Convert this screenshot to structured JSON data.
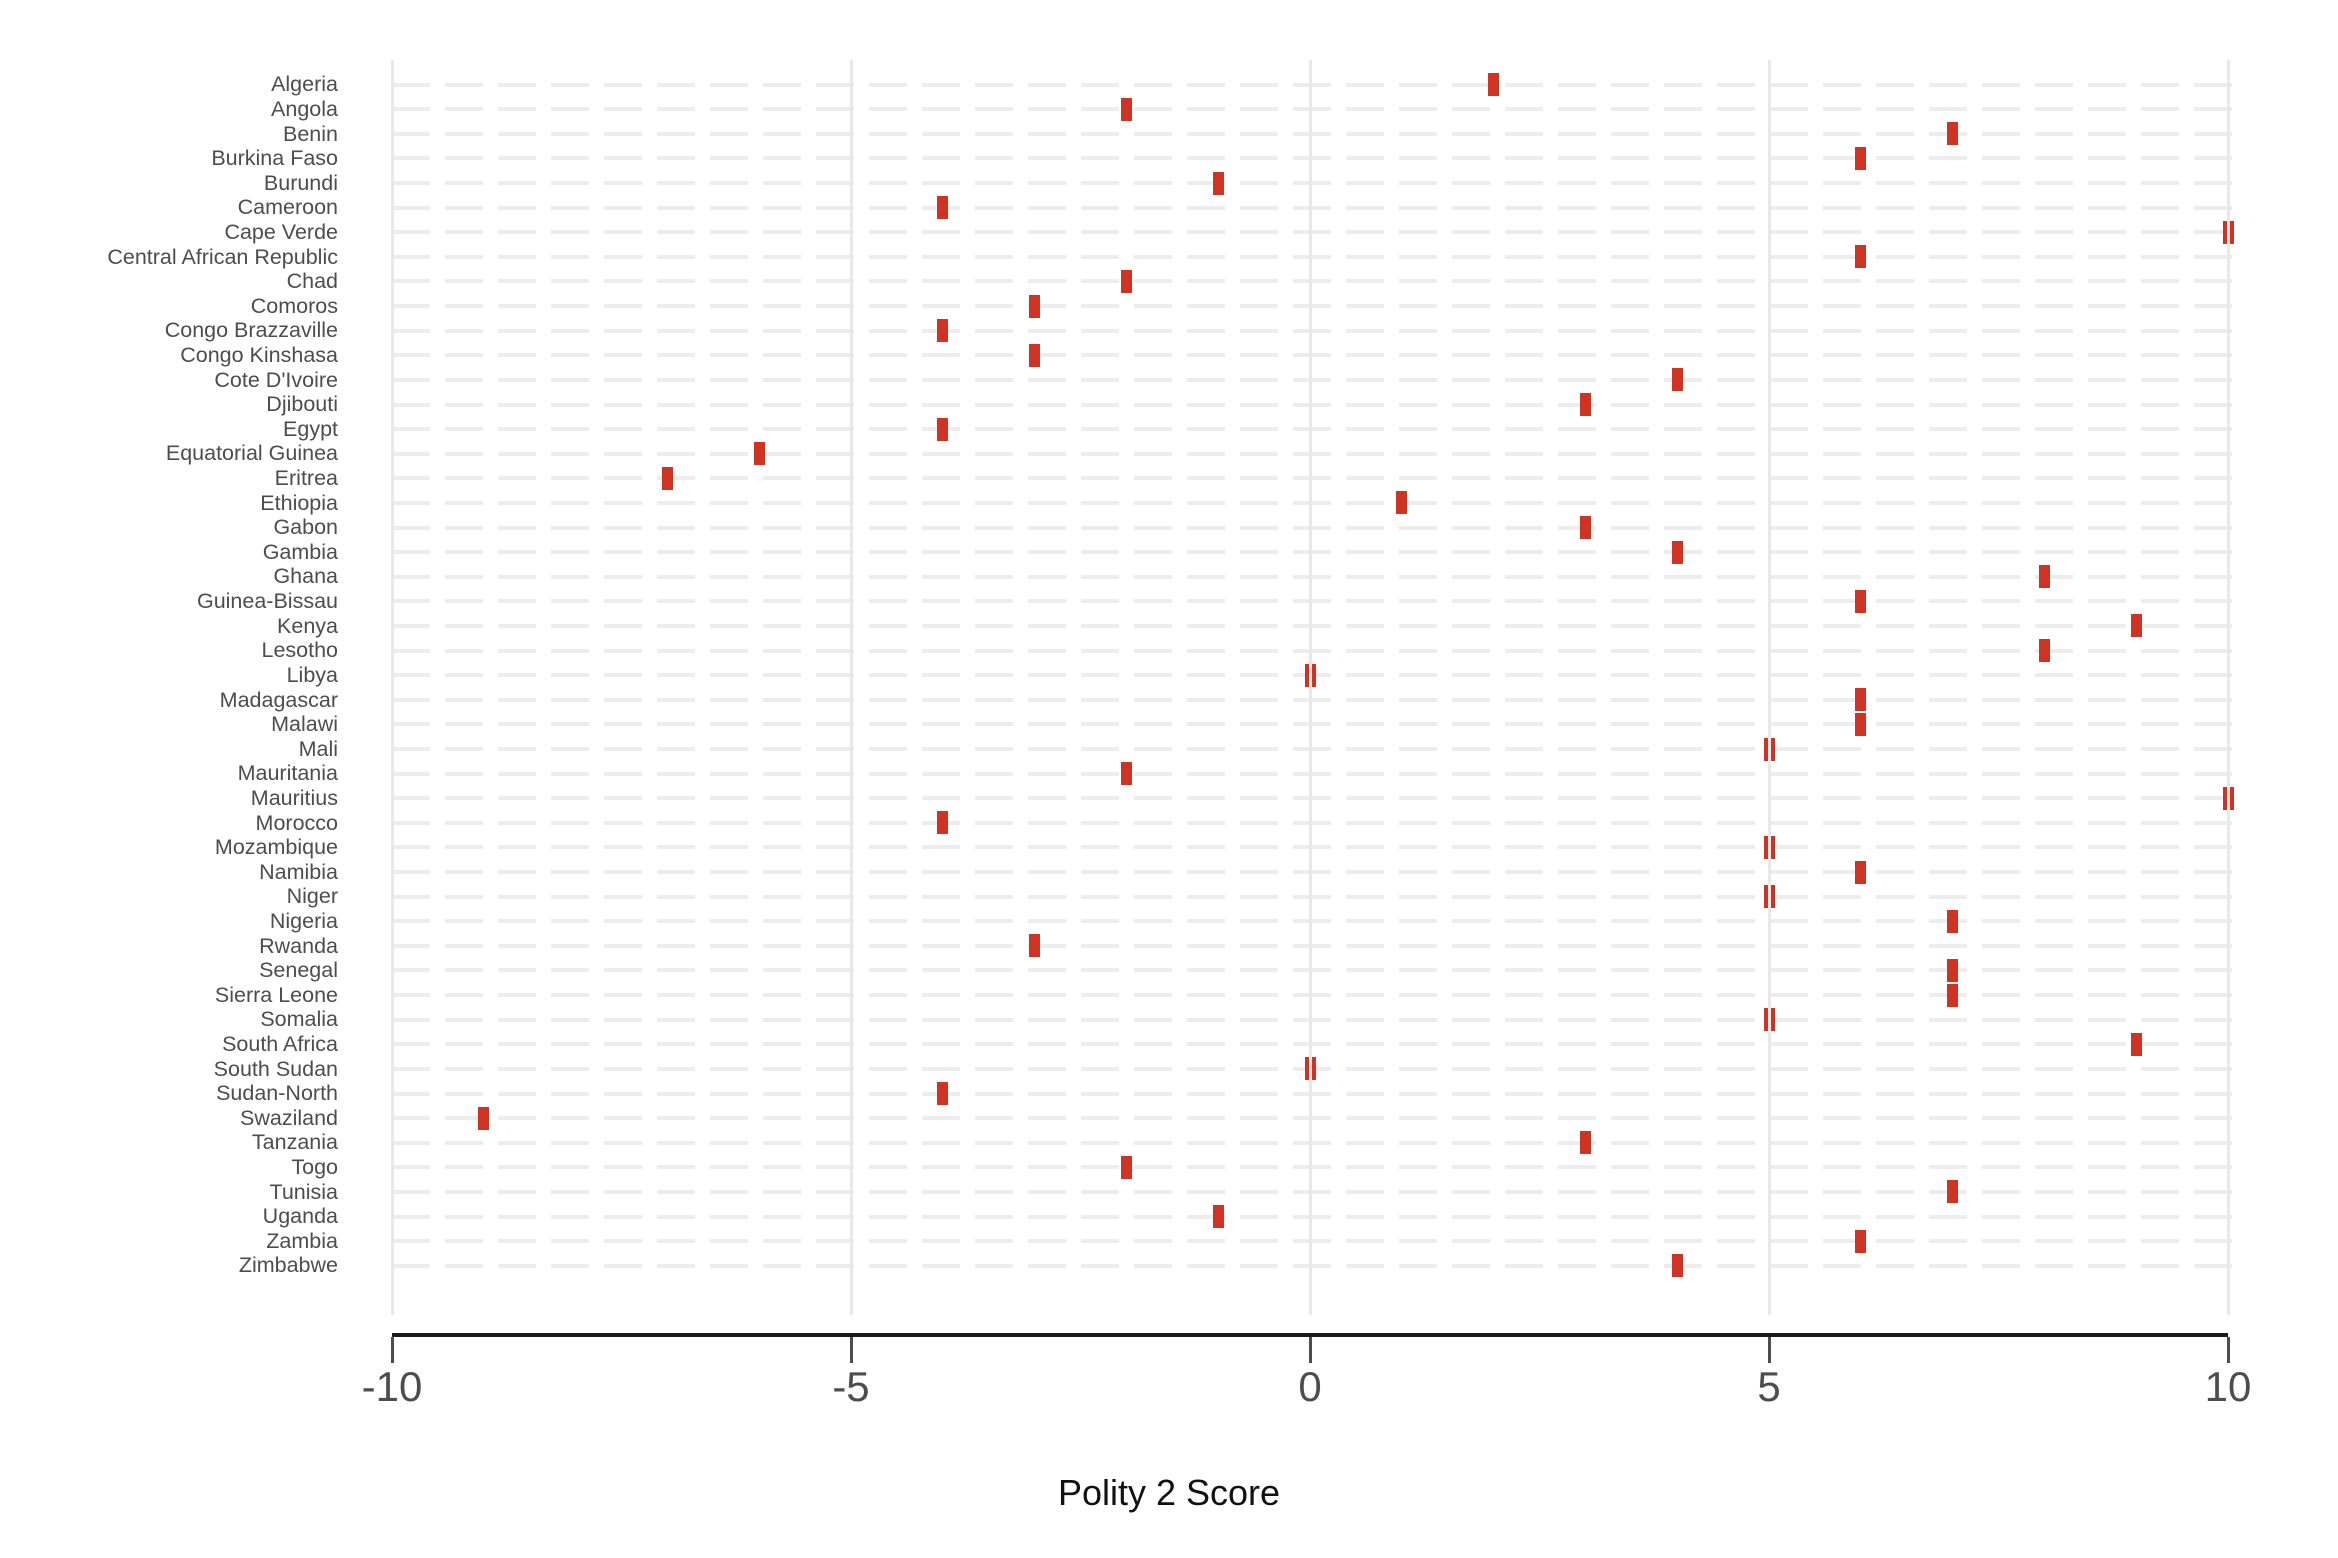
{
  "chart_data": {
    "type": "scatter",
    "title": "",
    "subtitle": "",
    "xlabel": "Polity 2 Score",
    "ylabel": "",
    "xlim": [
      -10,
      10
    ],
    "xticks": [
      -10,
      -5,
      0,
      5,
      10
    ],
    "xticklabels": [
      "-10",
      "-5",
      "0",
      "5",
      "10"
    ],
    "grid": "both-light-horizontal-dashed-and-vertical-major",
    "legend": "none",
    "marker_color": "#cf3323",
    "grid_color": "#ededed",
    "axis_color": "#4d4d4d",
    "categories": [
      "Algeria",
      "Angola",
      "Benin",
      "Burkina Faso",
      "Burundi",
      "Cameroon",
      "Cape Verde",
      "Central African Republic",
      "Chad",
      "Comoros",
      "Congo Brazzaville",
      "Congo Kinshasa",
      "Cote D'Ivoire",
      "Djibouti",
      "Egypt",
      "Equatorial Guinea",
      "Eritrea",
      "Ethiopia",
      "Gabon",
      "Gambia",
      "Ghana",
      "Guinea-Bissau",
      "Kenya",
      "Lesotho",
      "Libya",
      "Madagascar",
      "Malawi",
      "Mali",
      "Mauritania",
      "Mauritius",
      "Morocco",
      "Mozambique",
      "Namibia",
      "Niger",
      "Nigeria",
      "Rwanda",
      "Senegal",
      "Sierra Leone",
      "Somalia",
      "South Africa",
      "South Sudan",
      "Sudan-North",
      "Swaziland",
      "Tanzania",
      "Togo",
      "Tunisia",
      "Uganda",
      "Zambia",
      "Zimbabwe"
    ],
    "values": [
      2,
      -2,
      7,
      6,
      -1,
      -4,
      10,
      6,
      -2,
      -3,
      -4,
      -3,
      4,
      3,
      -4,
      -6,
      -7,
      1,
      3,
      4,
      8,
      6,
      9,
      8,
      0,
      6,
      6,
      5,
      -2,
      10,
      -4,
      5,
      6,
      5,
      7,
      -3,
      7,
      7,
      5,
      9,
      0,
      -4,
      -9,
      3,
      -2,
      7,
      -1,
      6,
      4
    ]
  }
}
